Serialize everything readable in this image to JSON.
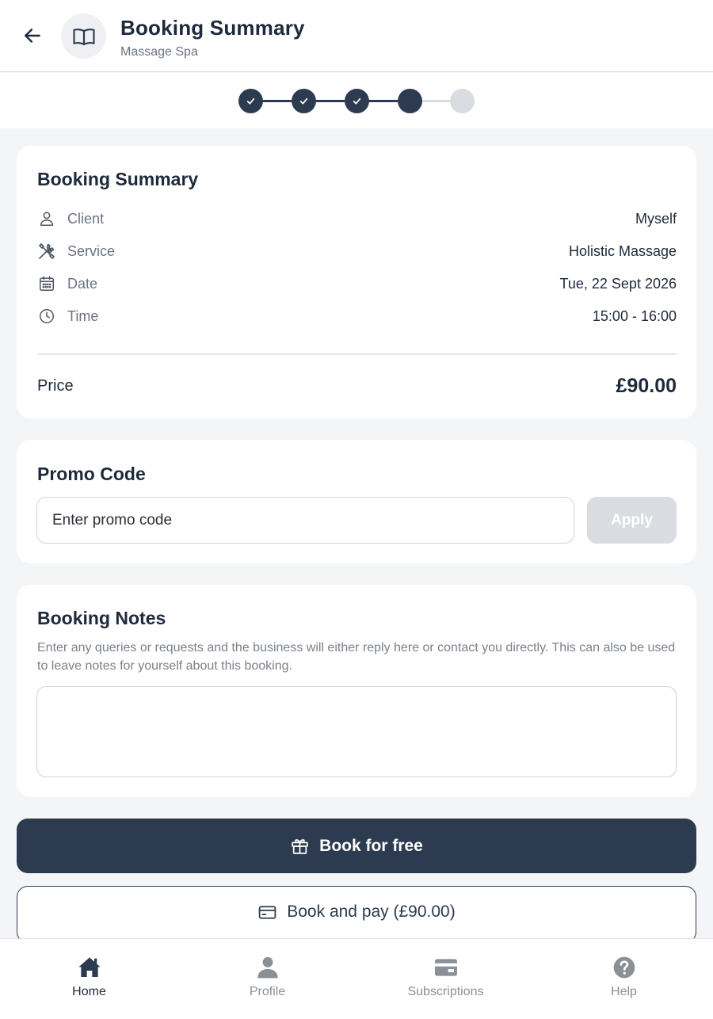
{
  "header": {
    "title": "Booking Summary",
    "subtitle": "Massage Spa",
    "back_icon": "arrow-left-icon",
    "avatar_icon": "open-book-icon"
  },
  "stepper": {
    "steps": [
      {
        "state": "completed"
      },
      {
        "state": "completed"
      },
      {
        "state": "completed"
      },
      {
        "state": "current"
      },
      {
        "state": "pending"
      }
    ]
  },
  "summary": {
    "title": "Booking Summary",
    "rows": [
      {
        "icon": "user-icon",
        "label": "Client",
        "value": "Myself"
      },
      {
        "icon": "tools-icon",
        "label": "Service",
        "value": "Holistic Massage"
      },
      {
        "icon": "calendar-icon",
        "label": "Date",
        "value": "Tue, 22 Sept 2026"
      },
      {
        "icon": "clock-icon",
        "label": "Time",
        "value": "15:00 - 16:00"
      }
    ],
    "price_label": "Price",
    "price_value": "£90.00"
  },
  "promo": {
    "title": "Promo Code",
    "placeholder": "Enter promo code",
    "value": "",
    "apply_label": "Apply"
  },
  "notes": {
    "title": "Booking Notes",
    "description": "Enter any queries or requests and the business will either reply here or contact you directly. This can also be used to leave notes for yourself about this booking.",
    "value": ""
  },
  "actions": {
    "book_free_label": "Book for free",
    "book_free_icon": "gift-icon",
    "book_pay_label": "Book and pay (£90.00)",
    "book_pay_icon": "credit-card-icon"
  },
  "bottom_nav": {
    "items": [
      {
        "label": "Home",
        "icon": "home-icon",
        "active": true
      },
      {
        "label": "Profile",
        "icon": "profile-icon",
        "active": false
      },
      {
        "label": "Subscriptions",
        "icon": "card-icon",
        "active": false
      },
      {
        "label": "Help",
        "icon": "help-icon",
        "active": false
      }
    ]
  },
  "colors": {
    "primary": "#2d3b50",
    "muted": "#d9dce1",
    "background": "#f4f5f7",
    "text": "#1e293b",
    "secondary_text": "#6b7280"
  }
}
